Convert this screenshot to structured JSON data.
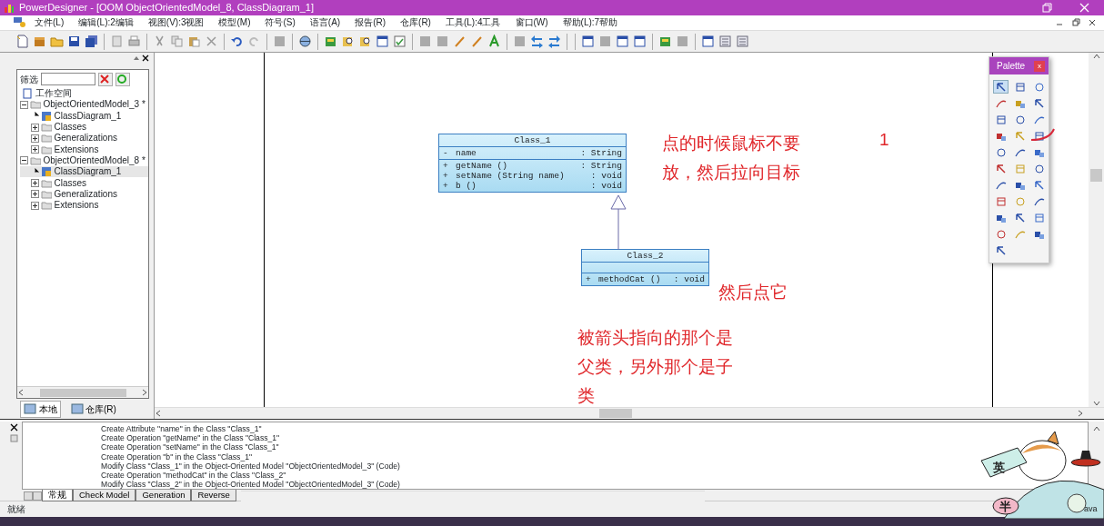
{
  "window": {
    "title": "PowerDesigner - [OOM ObjectOrientedModel_8, ClassDiagram_1]"
  },
  "menu": [
    "文件(L)",
    "编辑(L):2编辑",
    "视图(V):3视图",
    "模型(M)",
    "符号(S)",
    "语言(A)",
    "报告(R)",
    "仓库(R)",
    "工具(L):4工具",
    "窗口(W)",
    "帮助(L):7帮助"
  ],
  "browser": {
    "filter_label": "筛选",
    "tree": [
      {
        "label": "工作空间",
        "selected": false,
        "children": [
          {
            "label": "ObjectOrientedModel_3 *",
            "selected": false,
            "expanded": true,
            "children": [
              {
                "label": "ClassDiagram_1",
                "selected": false
              },
              {
                "label": "Classes",
                "selected": false,
                "expanded": false
              },
              {
                "label": "Generalizations",
                "selected": false,
                "expanded": false
              },
              {
                "label": "Extensions",
                "selected": false,
                "expanded": false
              }
            ]
          },
          {
            "label": "ObjectOrientedModel_8 *",
            "selected": false,
            "expanded": true,
            "children": [
              {
                "label": "ClassDiagram_1",
                "selected": true
              },
              {
                "label": "Classes",
                "selected": false,
                "expanded": false
              },
              {
                "label": "Generalizations",
                "selected": false,
                "expanded": false
              },
              {
                "label": "Extensions",
                "selected": false,
                "expanded": false
              }
            ]
          }
        ]
      }
    ],
    "tabs": [
      {
        "label": "本地",
        "selected": true
      },
      {
        "label": "仓库(R)",
        "selected": false
      }
    ]
  },
  "diagram": {
    "classes": [
      {
        "name": "Class_1",
        "attributes": [
          {
            "visibility": "-",
            "signature": "name",
            "type": ": String"
          }
        ],
        "operations": [
          {
            "visibility": "+",
            "signature": "getName ()",
            "type": ": String"
          },
          {
            "visibility": "+",
            "signature": "setName (String name)",
            "type": ": void"
          },
          {
            "visibility": "+",
            "signature": "b ()",
            "type": ": void"
          }
        ]
      },
      {
        "name": "Class_2",
        "operations": [
          {
            "visibility": "+",
            "signature": "methodCat ()",
            "type": ": void"
          }
        ]
      }
    ],
    "annotations": [
      "点的时候鼠标不要放，然后拉向目标",
      "1",
      "然后点它",
      "被箭头指向的那个是父类，另外那个是子类"
    ]
  },
  "palette": {
    "title": "Palette",
    "close": "x",
    "tools": [
      {
        "selected": true
      },
      {
        "selected": false
      },
      {
        "selected": false
      },
      {
        "selected": false
      },
      {
        "selected": false
      },
      {
        "selected": false
      },
      {
        "selected": false
      },
      {
        "selected": false
      },
      {
        "selected": false
      },
      {
        "selected": false
      },
      {
        "selected": false
      },
      {
        "selected": false
      },
      {
        "selected": false
      },
      {
        "selected": false
      },
      {
        "selected": false
      },
      {
        "selected": false
      },
      {
        "selected": false
      },
      {
        "selected": false
      },
      {
        "selected": false
      },
      {
        "selected": false
      },
      {
        "selected": false
      },
      {
        "selected": false
      },
      {
        "selected": false
      },
      {
        "selected": false
      },
      {
        "selected": false
      },
      {
        "selected": false
      },
      {
        "selected": false
      },
      {
        "selected": false
      },
      {
        "selected": false
      },
      {
        "selected": false
      },
      {
        "selected": false
      }
    ]
  },
  "output": {
    "lines": [
      "Create Attribute \"name\" in the Class \"Class_1\"",
      "Create Operation \"getName\" in the Class \"Class_1\"",
      "Create Operation \"setName\" in the Class \"Class_1\"",
      "Create Operation \"b\" in the Class \"Class_1\"",
      "Modify Class \"Class_1\" in the Object-Oriented Model \"ObjectOrientedModel_3\" (Code)",
      "Create Operation \"methodCat\" in the Class \"Class_2\"",
      "Modify Class \"Class_2\" in the Object-Oriented Model \"ObjectOrientedModel_3\" (Code)"
    ],
    "tabs": [
      {
        "label": "常规",
        "selected": true
      },
      {
        "label": "Check Model",
        "selected": false
      },
      {
        "label": "Generation",
        "selected": false
      },
      {
        "label": "Reverse",
        "selected": false
      }
    ]
  },
  "status_bar": "就绪",
  "ime": {
    "language": "英",
    "width": "半",
    "caption": "ava"
  }
}
